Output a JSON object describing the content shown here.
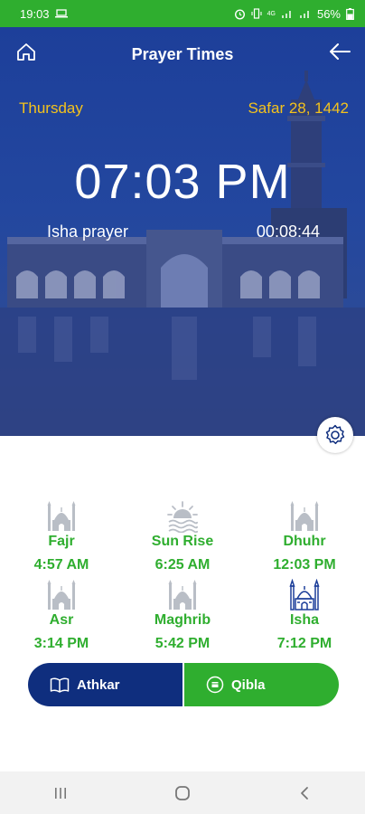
{
  "status_bar": {
    "time": "19:03",
    "battery": "56%",
    "network_label": "4G"
  },
  "header": {
    "title": "Prayer Times"
  },
  "hero": {
    "day": "Thursday",
    "hijri_date": "Safar 28, 1442",
    "clock": "07:03 PM",
    "next_prayer": "Isha prayer",
    "countdown": "00:08:44"
  },
  "prayers": [
    {
      "name": "Fajr",
      "time": "4:57 AM",
      "icon": "mosque-icon"
    },
    {
      "name": "Sun Rise",
      "time": "6:25 AM",
      "icon": "sunrise-icon"
    },
    {
      "name": "Dhuhr",
      "time": "12:03 PM",
      "icon": "mosque-icon"
    },
    {
      "name": "Asr",
      "time": "3:14 PM",
      "icon": "mosque-icon"
    },
    {
      "name": "Maghrib",
      "time": "5:42 PM",
      "icon": "mosque-icon"
    },
    {
      "name": "Isha",
      "time": "7:12 PM",
      "icon": "mosque-icon",
      "active": true
    }
  ],
  "actions": {
    "athkar_label": "Athkar",
    "qibla_label": "Qibla"
  },
  "colors": {
    "green": "#2fae2f",
    "navy": "#0f2e7e",
    "hero_blue": "#23479f",
    "gold": "#f4c21c",
    "inactive_icon": "#b9bec6"
  }
}
